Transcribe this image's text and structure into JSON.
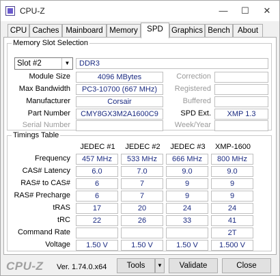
{
  "window": {
    "title": "CPU-Z",
    "minimize": "—",
    "maximize": "☐",
    "close": "✕"
  },
  "tabs": [
    "CPU",
    "Caches",
    "Mainboard",
    "Memory",
    "SPD",
    "Graphics",
    "Bench",
    "About"
  ],
  "active_tab": "SPD",
  "slot": {
    "group_title": "Memory Slot Selection",
    "selected": "Slot #2",
    "type": "DDR3",
    "labels": {
      "module_size": "Module Size",
      "max_bandwidth": "Max Bandwidth",
      "manufacturer": "Manufacturer",
      "part_number": "Part Number",
      "serial_number": "Serial Number",
      "correction": "Correction",
      "registered": "Registered",
      "buffered": "Buffered",
      "spd_ext": "SPD Ext.",
      "week_year": "Week/Year"
    },
    "values": {
      "module_size": "4096 MBytes",
      "max_bandwidth": "PC3-10700 (667 MHz)",
      "manufacturer": "Corsair",
      "part_number": "CMY8GX3M2A1600C9",
      "serial_number": "",
      "correction": "",
      "registered": "",
      "buffered": "",
      "spd_ext": "XMP 1.3",
      "week_year": ""
    }
  },
  "timings": {
    "group_title": "Timings Table",
    "columns": [
      "JEDEC #1",
      "JEDEC #2",
      "JEDEC #3",
      "XMP-1600"
    ],
    "rows": [
      {
        "label": "Frequency",
        "values": [
          "457 MHz",
          "533 MHz",
          "666 MHz",
          "800 MHz"
        ]
      },
      {
        "label": "CAS# Latency",
        "values": [
          "6.0",
          "7.0",
          "9.0",
          "9.0"
        ]
      },
      {
        "label": "RAS# to CAS#",
        "values": [
          "6",
          "7",
          "9",
          "9"
        ]
      },
      {
        "label": "RAS# Precharge",
        "values": [
          "6",
          "7",
          "9",
          "9"
        ]
      },
      {
        "label": "tRAS",
        "values": [
          "17",
          "20",
          "24",
          "24"
        ]
      },
      {
        "label": "tRC",
        "values": [
          "22",
          "26",
          "33",
          "41"
        ]
      },
      {
        "label": "Command Rate",
        "values": [
          "",
          "",
          "",
          "2T"
        ]
      },
      {
        "label": "Voltage",
        "values": [
          "1.50 V",
          "1.50 V",
          "1.50 V",
          "1.500 V"
        ]
      }
    ]
  },
  "footer": {
    "logo": "CPU-Z",
    "version": "Ver. 1.74.0.x64",
    "tools": "Tools",
    "validate": "Validate",
    "close": "Close"
  }
}
